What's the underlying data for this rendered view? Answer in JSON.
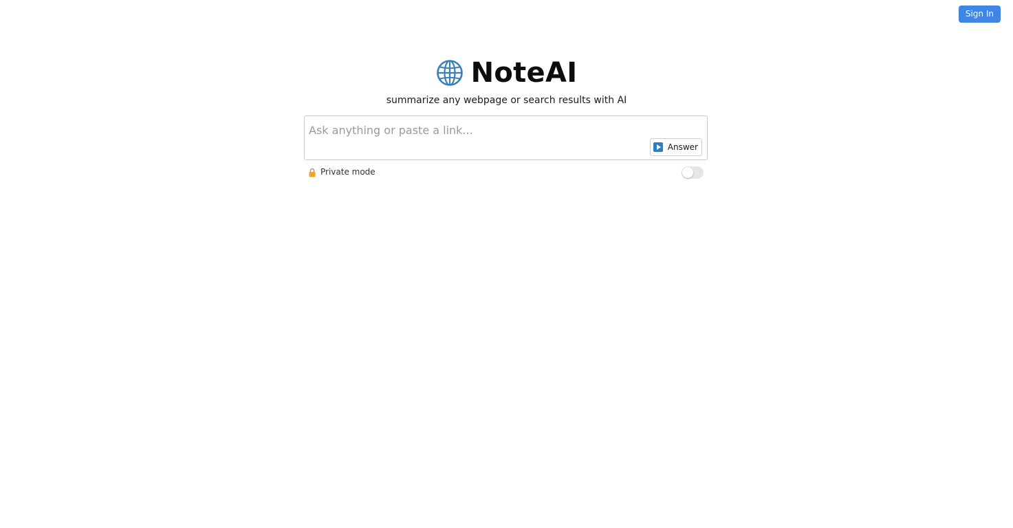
{
  "header": {
    "signin_label": "Sign In"
  },
  "brand": {
    "title": "NoteAI",
    "icon": "globe-icon",
    "tagline": "summarize any webpage or search results with AI"
  },
  "search": {
    "value": "",
    "placeholder": "Ask anything or paste a link...",
    "answer_label": "Answer",
    "answer_icon": "play-icon"
  },
  "private_mode": {
    "label": "Private mode",
    "icon": "lock-icon",
    "enabled": false
  },
  "colors": {
    "accent": "#3f85e6",
    "globe": "#3a7fb5",
    "play": "#2f7fc0",
    "lock": "#f0a531"
  }
}
